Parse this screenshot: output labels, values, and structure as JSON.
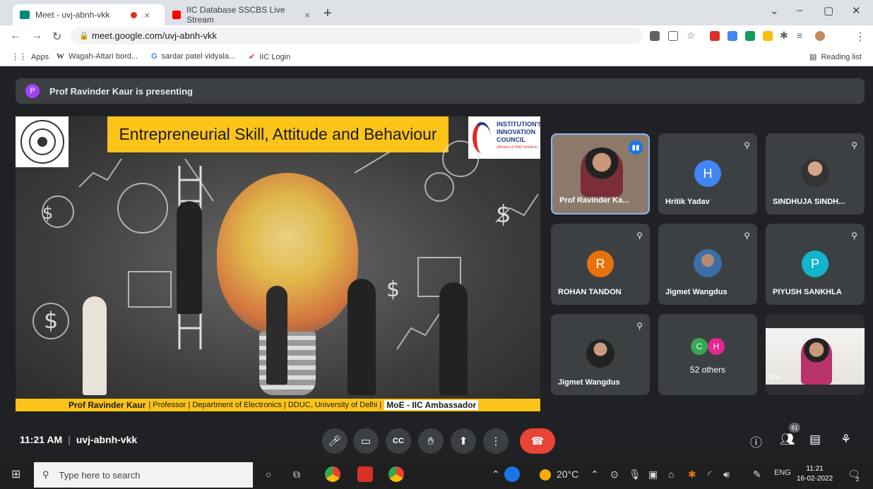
{
  "browser": {
    "tabs": [
      {
        "title": "Meet - uvj-abnh-vkk",
        "close": "×"
      },
      {
        "title": "IIC Database SSCBS Live Stream",
        "close": "×"
      }
    ],
    "new_tab": "+",
    "window_controls": [
      "⌄",
      "–",
      "▢",
      "✕"
    ],
    "url": "meet.google.com/uvj-abnh-vkk",
    "bookmarks": [
      {
        "label": "Apps",
        "icon": "apps-grid-icon"
      },
      {
        "label": "Wagah-Attari bord...",
        "icon": "wikipedia-icon"
      },
      {
        "label": "sardar patel vidyala...",
        "icon": "google-icon"
      },
      {
        "label": "IIC Login",
        "icon": "iic-icon"
      }
    ],
    "reading_list": "Reading list"
  },
  "meet": {
    "presenting_banner": "Prof Ravinder Kaur is presenting",
    "presenter_initial": "P",
    "slide": {
      "title": "Entrepreneurial Skill, Attitude and Behaviour",
      "logo_right": [
        "INSTITUTION'S",
        "INNOVATION",
        "COUNCIL",
        "(Ministry of HRD Initiative)"
      ],
      "footer_name": "Prof Ravinder Kaur",
      "footer_rest": "| Professor | Department of Electronics | DDUC, University of Delhi |",
      "footer_role": "MoE - IIC Ambassador"
    },
    "participants": [
      {
        "name": "Prof Ravinder Ka...",
        "type": "video",
        "speaking": true
      },
      {
        "name": "Hritik Yadav",
        "type": "initial",
        "initial": "H",
        "color": "#4285f4",
        "muted": true
      },
      {
        "name": "SINDHUJA SINDH...",
        "type": "photo",
        "muted": true
      },
      {
        "name": "ROHAN TANDON",
        "type": "initial",
        "initial": "R",
        "color": "#e8710a",
        "muted": true
      },
      {
        "name": "Jigmet Wangdus",
        "type": "photo",
        "muted": true
      },
      {
        "name": "PIYUSH SANKHLA",
        "type": "initial",
        "initial": "P",
        "color": "#12b5cb",
        "muted": true
      },
      {
        "name": "Jigmet Wangdus",
        "type": "photo",
        "muted": true
      },
      {
        "name": "52 others",
        "type": "others",
        "initials": [
          "C",
          "H"
        ],
        "colors": [
          "#34a853",
          "#e52592"
        ]
      },
      {
        "name": "You",
        "type": "self"
      }
    ],
    "time": "11:21 AM",
    "meeting_code": "uvj-abnh-vkk",
    "people_count": "61"
  },
  "taskbar": {
    "search_placeholder": "Type here to search",
    "weather": "20°C",
    "language": "ENG",
    "time": "11:21",
    "date": "16-02-2022",
    "notifications": "2"
  }
}
